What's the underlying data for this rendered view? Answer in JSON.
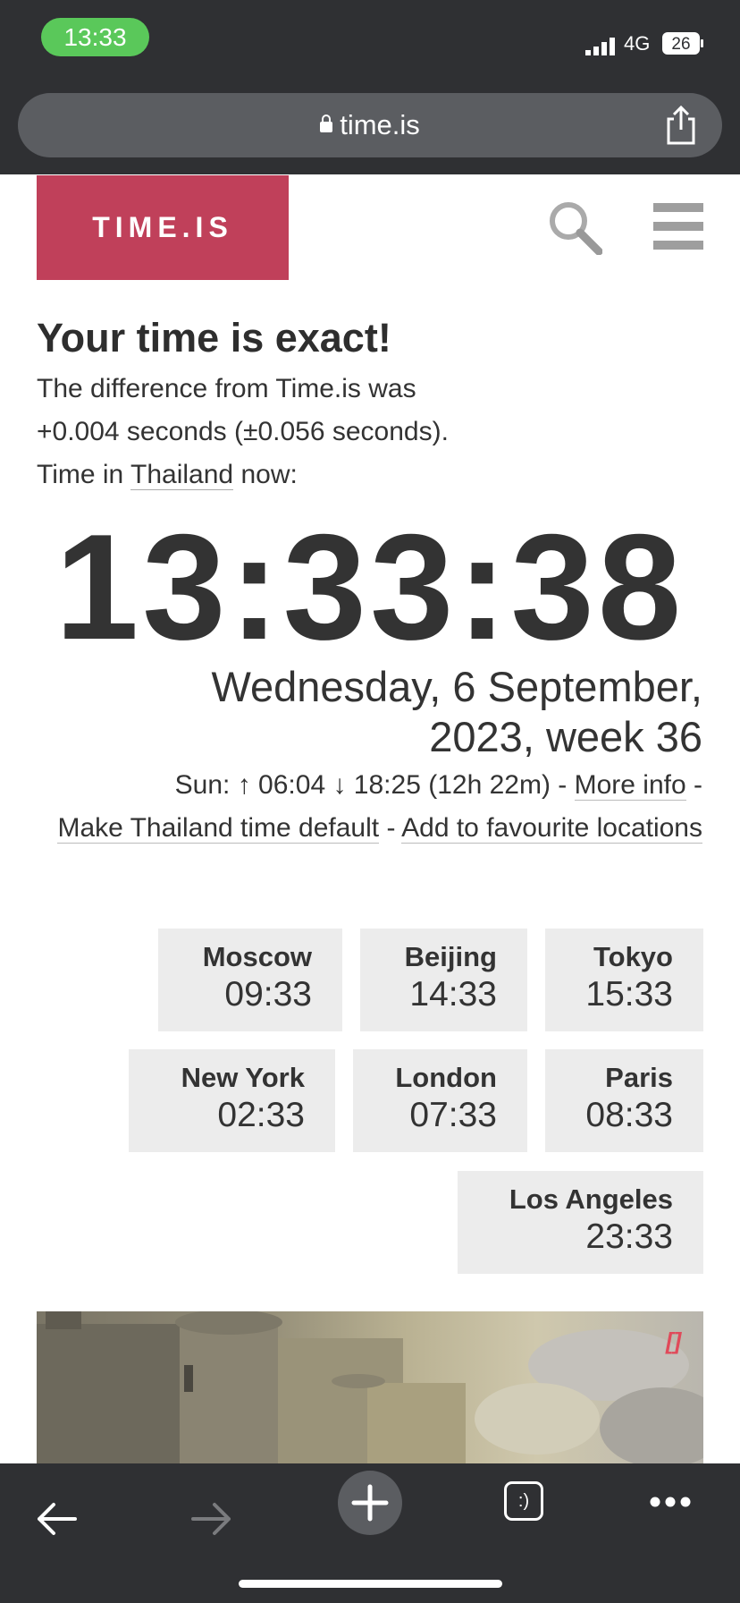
{
  "status": {
    "time": "13:33",
    "network": "4G",
    "battery": "26"
  },
  "browser": {
    "url": "time.is"
  },
  "site": {
    "logo": "TIME.IS"
  },
  "main": {
    "headline": "Your time is exact!",
    "diff_line1": "The difference from Time.is was",
    "diff_line2": "+0.004 seconds (±0.056 seconds).",
    "time_in_prefix": "Time in ",
    "country": "Thailand",
    "time_in_suffix": " now:",
    "clock": "13:33:38",
    "date_line1": "Wednesday, 6 September,",
    "date_line2": "2023, week 36",
    "sun_info": "Sun: ↑ 06:04 ↓ 18:25 (12h 22m) - ",
    "more_info": "More info",
    "sep1": " -",
    "make_default": "Make Thailand time default",
    "sep2": " - ",
    "add_fav": "Add to favourite locations"
  },
  "cities": [
    {
      "name": "Moscow",
      "time": "09:33"
    },
    {
      "name": "Beijing",
      "time": "14:33"
    },
    {
      "name": "Tokyo",
      "time": "15:33"
    },
    {
      "name": "New York",
      "time": "02:33"
    },
    {
      "name": "London",
      "time": "07:33"
    },
    {
      "name": "Paris",
      "time": "08:33"
    },
    {
      "name": "Los Angeles",
      "time": "23:33"
    }
  ],
  "image_badge": "[]",
  "toolbar": {
    "tabs_label": ":)"
  }
}
